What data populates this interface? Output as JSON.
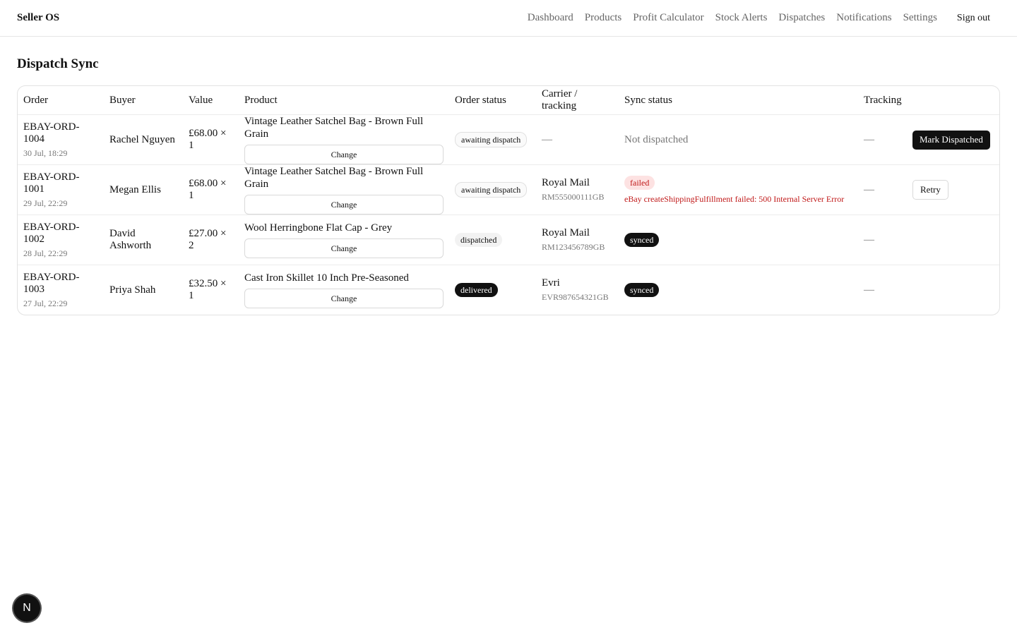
{
  "header": {
    "brand": "Seller OS",
    "nav": [
      "Dashboard",
      "Products",
      "Profit Calculator",
      "Stock Alerts",
      "Dispatches",
      "Notifications",
      "Settings"
    ],
    "signout": "Sign out"
  },
  "page": {
    "title": "Dispatch Sync"
  },
  "table": {
    "columns": [
      "Order",
      "Buyer",
      "Value",
      "Product",
      "Order status",
      "Carrier / tracking",
      "Sync status",
      "Tracking",
      ""
    ],
    "change_label": "Change",
    "rows": [
      {
        "order_id": "EBAY-ORD-1004",
        "date": "30 Jul, 18:29",
        "buyer": "Rachel Nguyen",
        "value": "£68.00 × 1",
        "product": "Vintage Leather Satchel Bag - Brown Full Grain",
        "order_status": "awaiting dispatch",
        "carrier": "—",
        "tracking_no": "",
        "sync_status": "Not dispatched",
        "sync_error": "",
        "tracking": "—",
        "action": "Mark Dispatched"
      },
      {
        "order_id": "EBAY-ORD-1001",
        "date": "29 Jul, 22:29",
        "buyer": "Megan Ellis",
        "value": "£68.00 × 1",
        "product": "Vintage Leather Satchel Bag - Brown Full Grain",
        "order_status": "awaiting dispatch",
        "carrier": "Royal Mail",
        "tracking_no": "RM555000111GB",
        "sync_status": "failed",
        "sync_error": "eBay createShippingFulfillment failed: 500 Internal Server Error",
        "tracking": "—",
        "action": "Retry"
      },
      {
        "order_id": "EBAY-ORD-1002",
        "date": "28 Jul, 22:29",
        "buyer": "David Ashworth",
        "value": "£27.00 × 2",
        "product": "Wool Herringbone Flat Cap - Grey",
        "order_status": "dispatched",
        "carrier": "Royal Mail",
        "tracking_no": "RM123456789GB",
        "sync_status": "synced",
        "sync_error": "",
        "tracking": "—",
        "action": ""
      },
      {
        "order_id": "EBAY-ORD-1003",
        "date": "27 Jul, 22:29",
        "buyer": "Priya Shah",
        "value": "£32.50 × 1",
        "product": "Cast Iron Skillet 10 Inch Pre-Seasoned",
        "order_status": "delivered",
        "carrier": "Evri",
        "tracking_no": "EVR987654321GB",
        "sync_status": "synced",
        "sync_error": "",
        "tracking": "—",
        "action": ""
      }
    ]
  },
  "dev_badge": {
    "letter": "N"
  }
}
